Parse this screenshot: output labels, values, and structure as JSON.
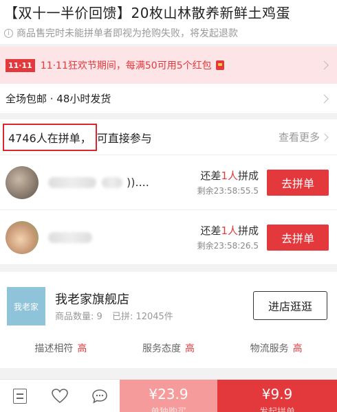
{
  "product": {
    "title": "【双十一半价回馈】20枚山林散养新鲜土鸡蛋",
    "notice": "商品售完时未能拼单者即视为抢购失败，将发起退款"
  },
  "promo": {
    "badge": "11·11",
    "text": "11·11狂欢节期间，每满50可用5个红包"
  },
  "shipping": {
    "text": "全场包邮 · 48小时发货"
  },
  "groups": {
    "count_text": "4746人在拼单，",
    "suffix": "可直接参与",
    "more": "查看更多",
    "items": [
      {
        "name_tail": "))....",
        "need": "还差",
        "need_count": "1人",
        "need_tail": "拼成",
        "remaining": "剩余23:58:55.5",
        "button": "去拼单"
      },
      {
        "name_tail": "",
        "need": "还差",
        "need_count": "1人",
        "need_tail": "拼成",
        "remaining": "剩余23:58:26.5",
        "button": "去拼单"
      }
    ]
  },
  "shop": {
    "logo_text": "我老家",
    "name": "我老家旗舰店",
    "product_count": "商品数量: 9",
    "sold": "已拼: 12045件",
    "enter_button": "进店逛逛",
    "ratings": [
      {
        "label": "描述相符",
        "level": "高"
      },
      {
        "label": "服务态度",
        "level": "高"
      },
      {
        "label": "物流服务",
        "level": "高"
      }
    ]
  },
  "bottom_bar": {
    "icons": [
      "list-icon",
      "heart-icon",
      "chat-icon"
    ],
    "solo_price": "¥23.9",
    "solo_label": "单独购买",
    "group_price": "¥9.9",
    "group_label": "发起拼单"
  },
  "colors": {
    "accent": "#e4393c",
    "promo_bg": "#fde4e6",
    "shop_logo": "#8ec3d9"
  }
}
